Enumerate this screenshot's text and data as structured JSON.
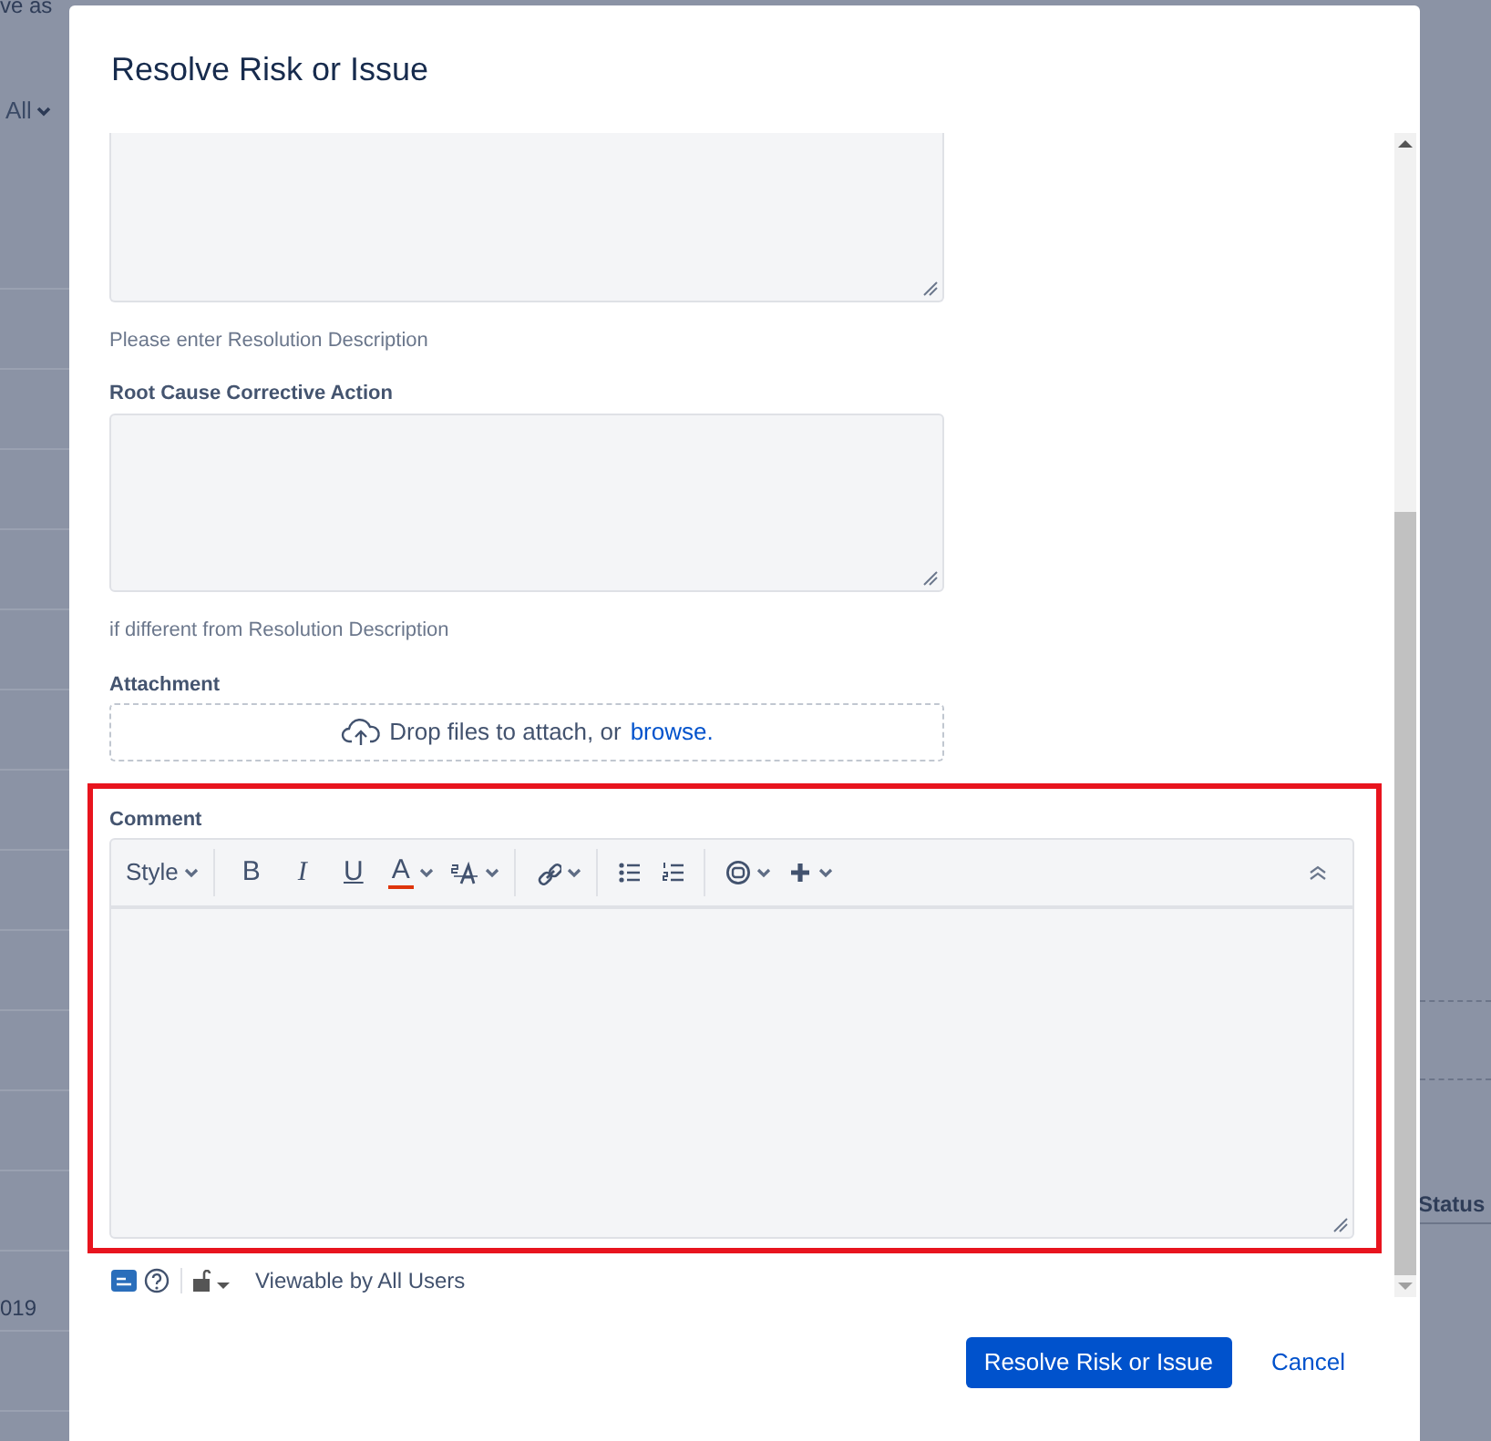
{
  "background": {
    "texts": [
      {
        "kind": "top",
        "text": "ve as"
      },
      {
        "kind": "filter",
        "text": "All"
      },
      {
        "kind": "date",
        "text": "019"
      },
      {
        "kind": "column",
        "text": "Status"
      }
    ]
  },
  "dialog": {
    "title": "Resolve Risk or Issue",
    "fields": [
      {
        "kind": "textarea",
        "cut_top": true,
        "help": "Please enter Resolution Description"
      },
      {
        "kind": "textarea",
        "label": "Root Cause Corrective Action",
        "help": "if different from Resolution Description"
      },
      {
        "kind": "dropzone",
        "label": "Attachment",
        "text": "Drop files to attach, or",
        "link": "browse."
      }
    ],
    "comment": {
      "label": "Comment",
      "highlighted": true,
      "toolbar_groups": [
        [
          {
            "kind": "style",
            "label": "Style",
            "dropdown": true
          }
        ],
        [
          {
            "kind": "bold",
            "label": "B",
            "dropdown": false
          },
          {
            "kind": "italic",
            "label": "I",
            "dropdown": false
          },
          {
            "kind": "underline",
            "label": "U",
            "dropdown": false
          },
          {
            "kind": "color",
            "label": "A",
            "dropdown": true
          },
          {
            "kind": "textsize",
            "dropdown": true
          }
        ],
        [
          {
            "kind": "link",
            "dropdown": true
          }
        ],
        [
          {
            "kind": "bullets",
            "dropdown": false
          },
          {
            "kind": "numbers",
            "dropdown": false
          }
        ],
        [
          {
            "kind": "emoji",
            "dropdown": true
          },
          {
            "kind": "plus",
            "dropdown": true
          }
        ]
      ],
      "visibility": "Viewable by All Users"
    },
    "buttons": [
      {
        "kind": "primary",
        "label": "Resolve Risk or Issue"
      },
      {
        "kind": "link",
        "label": "Cancel"
      }
    ]
  }
}
